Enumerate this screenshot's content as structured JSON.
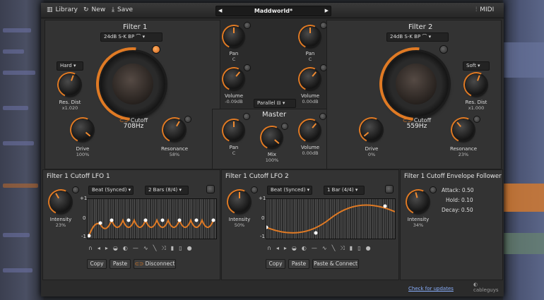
{
  "toolbar": {
    "library_label": "Library",
    "new_label": "New",
    "save_label": "Save",
    "preset_name": "Maddworld*",
    "midi_label": "MIDI"
  },
  "filter1": {
    "title": "Filter 1",
    "type": "24dB S-K BP",
    "dist_mode": "Hard",
    "res_dist_label": "Res. Dist",
    "res_dist_value": "x1.020",
    "cutoff_label": "Cutoff",
    "cutoff_value": "708Hz",
    "drive_label": "Drive",
    "drive_value": "100%",
    "resonance_label": "Resonance",
    "resonance_value": "58%"
  },
  "filter2": {
    "title": "Filter 2",
    "type": "24dB S-K BP",
    "dist_mode": "Soft",
    "res_dist_label": "Res. Dist",
    "res_dist_value": "x1.000",
    "cutoff_label": "Cutoff",
    "cutoff_value": "559Hz",
    "drive_label": "Drive",
    "drive_value": "0%",
    "resonance_label": "Resonance",
    "resonance_value": "23%"
  },
  "center": {
    "pan1_label": "Pan",
    "pan1_value": "C",
    "vol1_label": "Volume",
    "vol1_value": "-0.09dB",
    "pan2_label": "Pan",
    "pan2_value": "C",
    "vol2_label": "Volume",
    "vol2_value": "0.00dB",
    "routing": "Parallel"
  },
  "master": {
    "title": "Master",
    "pan_label": "Pan",
    "pan_value": "C",
    "mix_label": "Mix",
    "mix_value": "100%",
    "volume_label": "Volume",
    "volume_value": "0.00dB"
  },
  "lfo1": {
    "title": "Filter 1 Cutoff LFO 1",
    "sync": "Beat (Synced)",
    "length": "2 Bars (8/4)",
    "intensity_label": "Intensity",
    "intensity_value": "23%",
    "axis_top": "+1",
    "axis_mid": "0",
    "axis_bot": "-1",
    "copy_label": "Copy",
    "paste_label": "Paste",
    "disconnect_label": "Disconnect"
  },
  "lfo2": {
    "title": "Filter 1 Cutoff LFO 2",
    "sync": "Beat (Synced)",
    "length": "1 Bar (4/4)",
    "intensity_label": "Intensity",
    "intensity_value": "50%",
    "axis_top": "+1",
    "axis_mid": "0",
    "axis_bot": "-1",
    "copy_label": "Copy",
    "paste_label": "Paste",
    "paste_connect_label": "Paste & Connect"
  },
  "env": {
    "title": "Filter 1 Cutoff Envelope Follower",
    "intensity_label": "Intensity",
    "intensity_value": "34%",
    "attack_label": "Attack:",
    "attack_value": "0.50",
    "hold_label": "Hold:",
    "hold_value": "0.10",
    "decay_label": "Decay:",
    "decay_value": "0.50"
  },
  "footer": {
    "check_updates": "Check for updates",
    "brand": "cableguys"
  },
  "colors": {
    "accent": "#e07a24",
    "panel": "#333333",
    "background": "#2b2b2b"
  }
}
